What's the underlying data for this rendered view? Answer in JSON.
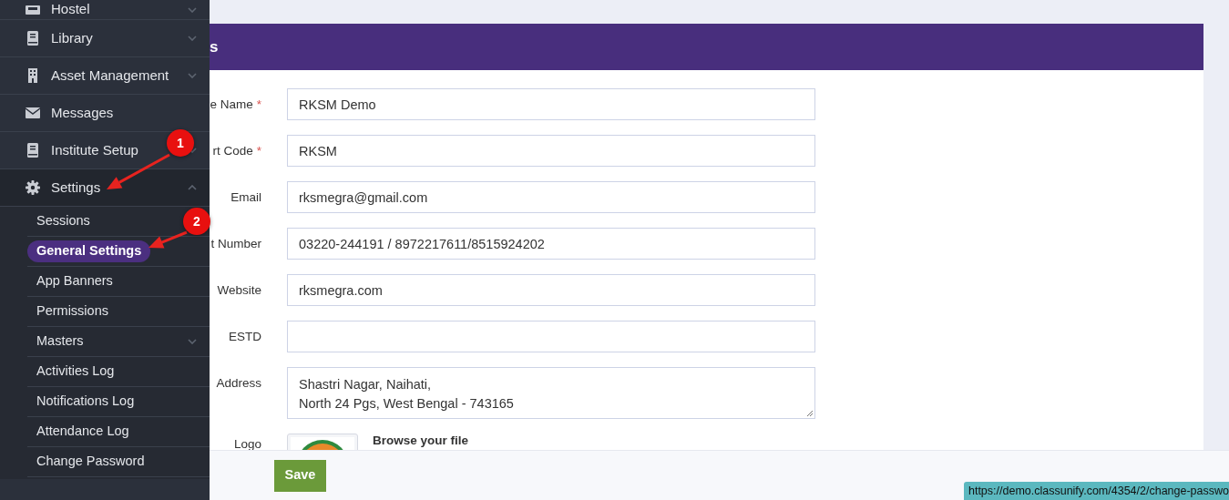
{
  "sidebar": {
    "items": [
      {
        "label": "Hostel",
        "has_caret": true,
        "expanded": false
      },
      {
        "label": "Library",
        "has_caret": true,
        "expanded": false
      },
      {
        "label": "Asset Management",
        "has_caret": true,
        "expanded": false
      },
      {
        "label": "Messages",
        "has_caret": false,
        "expanded": false
      },
      {
        "label": "Institute Setup",
        "has_caret": true,
        "expanded": false
      },
      {
        "label": "Settings",
        "has_caret": true,
        "expanded": true,
        "children": [
          {
            "label": "Sessions",
            "selected": false,
            "has_caret": false
          },
          {
            "label": "General Settings",
            "selected": true,
            "has_caret": false
          },
          {
            "label": "App Banners",
            "selected": false,
            "has_caret": false
          },
          {
            "label": "Permissions",
            "selected": false,
            "has_caret": false
          },
          {
            "label": "Masters",
            "selected": false,
            "has_caret": true
          },
          {
            "label": "Activities Log",
            "selected": false,
            "has_caret": false
          },
          {
            "label": "Notifications Log",
            "selected": false,
            "has_caret": false
          },
          {
            "label": "Attendance Log",
            "selected": false,
            "has_caret": false
          },
          {
            "label": "Change Password",
            "selected": false,
            "has_caret": false
          }
        ]
      }
    ]
  },
  "card": {
    "title": "s",
    "fields": [
      {
        "label": "e Name",
        "required_mark": "*",
        "kind": "input",
        "value": "RKSM Demo"
      },
      {
        "label": "rt Code",
        "required_mark": "*",
        "kind": "input",
        "value": "RKSM"
      },
      {
        "label": "Email",
        "kind": "input",
        "value": "rksmegra@gmail.com"
      },
      {
        "label": "t Number",
        "kind": "input",
        "value": "03220-244191 / 8972217611/8515924202"
      },
      {
        "label": "Website",
        "kind": "input",
        "value": "rksmegra.com"
      },
      {
        "label": "ESTD",
        "kind": "input"
      },
      {
        "label": "Address",
        "kind": "textarea",
        "lines": [
          "Shastri Nagar, Naihati,",
          "North 24 Pgs, West Bengal - 743165"
        ]
      },
      {
        "label": "Logo",
        "kind": "file",
        "browse_label": "Browse your file"
      }
    ]
  },
  "footer": {
    "save_button": "Save"
  },
  "annotations": [
    {
      "number": "1"
    },
    {
      "number": "2"
    }
  ],
  "status_url": "https://demo.classunify.com/4354/2/change-passwo"
}
